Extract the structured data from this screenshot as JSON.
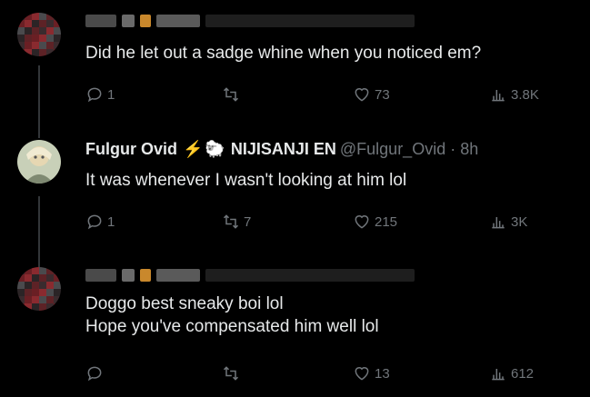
{
  "tweets": [
    {
      "author_name": "",
      "text": "Did he let out a sadge whine when you noticed em?",
      "replies": "1",
      "retweets": "",
      "likes": "73",
      "views": "3.8K",
      "avatar_colors": [
        "#3a2b2e",
        "#6a1f24",
        "#8a2a2f",
        "#4a4a4d",
        "#2b2426",
        "#5d2226"
      ]
    },
    {
      "author_name": "Fulgur Ovid",
      "emoji_bolt": "⚡",
      "emoji_sheep": "🐑",
      "org": "NIJISANJI EN",
      "handle": "@Fulgur_Ovid · 8h",
      "text": "It was whenever I wasn't looking at him lol",
      "replies": "1",
      "retweets": "7",
      "likes": "215",
      "views": "3K"
    },
    {
      "author_name": "",
      "text": "Doggo best sneaky boi lol\nHope you've compensated him well lol",
      "replies": "",
      "retweets": "",
      "likes": "13",
      "views": "612",
      "avatar_colors": [
        "#3a2b2e",
        "#6a1f24",
        "#8a2a2f",
        "#4a4a4d",
        "#2b2426",
        "#5d2226"
      ]
    }
  ],
  "colors": {
    "background": "#000000",
    "text": "#e7e9ea",
    "muted": "#71767b",
    "thread": "#333639"
  },
  "icons": [
    "reply-icon",
    "retweet-icon",
    "like-icon",
    "views-icon"
  ]
}
